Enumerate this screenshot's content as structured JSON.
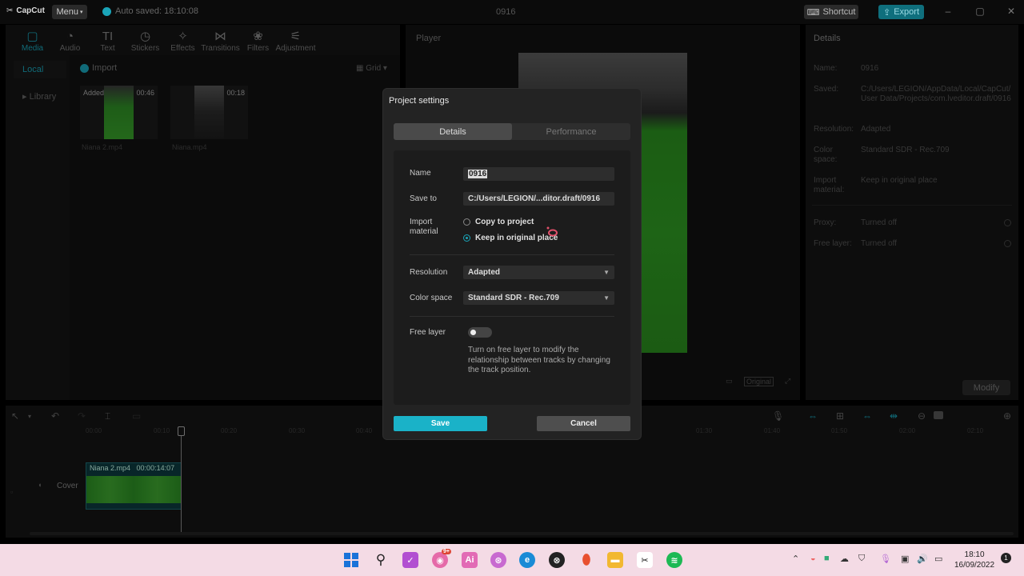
{
  "titlebar": {
    "logo": "CapCut",
    "menu_label": "Menu",
    "autosave": "Auto saved: 18:10:08",
    "project_title": "0916",
    "shortcut_label": "Shortcut",
    "export_label": "Export"
  },
  "media": {
    "tabs": [
      {
        "label": "Media",
        "icon": "▢"
      },
      {
        "label": "Audio",
        "icon": "◔"
      },
      {
        "label": "Text",
        "icon": "TI"
      },
      {
        "label": "Stickers",
        "icon": "◷"
      },
      {
        "label": "Effects",
        "icon": "✧"
      },
      {
        "label": "Transitions",
        "icon": "⋈"
      },
      {
        "label": "Filters",
        "icon": "❀"
      },
      {
        "label": "Adjustment",
        "icon": "⚟"
      }
    ],
    "side_local": "Local",
    "side_library": "▸ Library",
    "import_label": "Import",
    "grid_label": "Grid",
    "clips": [
      {
        "name": "Niana 2.mp4",
        "duration": "00:46",
        "added": "Added"
      },
      {
        "name": "Niana.mp4",
        "duration": "00:18"
      }
    ]
  },
  "player": {
    "title": "Player",
    "original_label": "Original"
  },
  "details": {
    "title": "Details",
    "rows": [
      {
        "label": "Name:",
        "value": "0916"
      },
      {
        "label": "Saved:",
        "value": "C:/Users/LEGION/AppData/Local/CapCut/User Data/Projects/com.lveditor.draft/0916"
      },
      {
        "label": "Resolution:",
        "value": "Adapted"
      },
      {
        "label": "Color space:",
        "value": "Standard SDR - Rec.709"
      },
      {
        "label": "Import material:",
        "value": "Keep in original place"
      },
      {
        "label": "Proxy:",
        "value": "Turned off"
      },
      {
        "label": "Free layer:",
        "value": "Turned off"
      }
    ],
    "modify_label": "Modify"
  },
  "timeline": {
    "ticks": [
      "00:00",
      "00:10",
      "00:20",
      "00:30",
      "00:40",
      "01:30",
      "01:40",
      "01:50",
      "02:00",
      "02:10"
    ],
    "cover_label": "Cover",
    "clip_name": "Niana 2.mp4",
    "clip_duration": "00:00:14:07"
  },
  "dialog": {
    "title": "Project settings",
    "tab_details": "Details",
    "tab_performance": "Performance",
    "name_label": "Name",
    "name_value": "0916",
    "save_to_label": "Save to",
    "save_to_value": "C:/Users/LEGION/...ditor.draft/0916",
    "import_label": "Import material",
    "import_option_copy": "Copy to project",
    "import_option_keep": "Keep in original place",
    "resolution_label": "Resolution",
    "resolution_value": "Adapted",
    "color_space_label": "Color space",
    "color_space_value": "Standard SDR - Rec.709",
    "free_layer_label": "Free layer",
    "free_layer_help": "Turn on free layer to modify the relationship between tracks by changing the track position.",
    "save_label": "Save",
    "cancel_label": "Cancel"
  },
  "taskbar": {
    "time": "18:10",
    "date": "16/09/2022",
    "badge": "9+"
  },
  "colors": {
    "accent": "#1aa4b8",
    "save_button": "#1ab2c8",
    "taskbar": "#f4dbe5"
  }
}
